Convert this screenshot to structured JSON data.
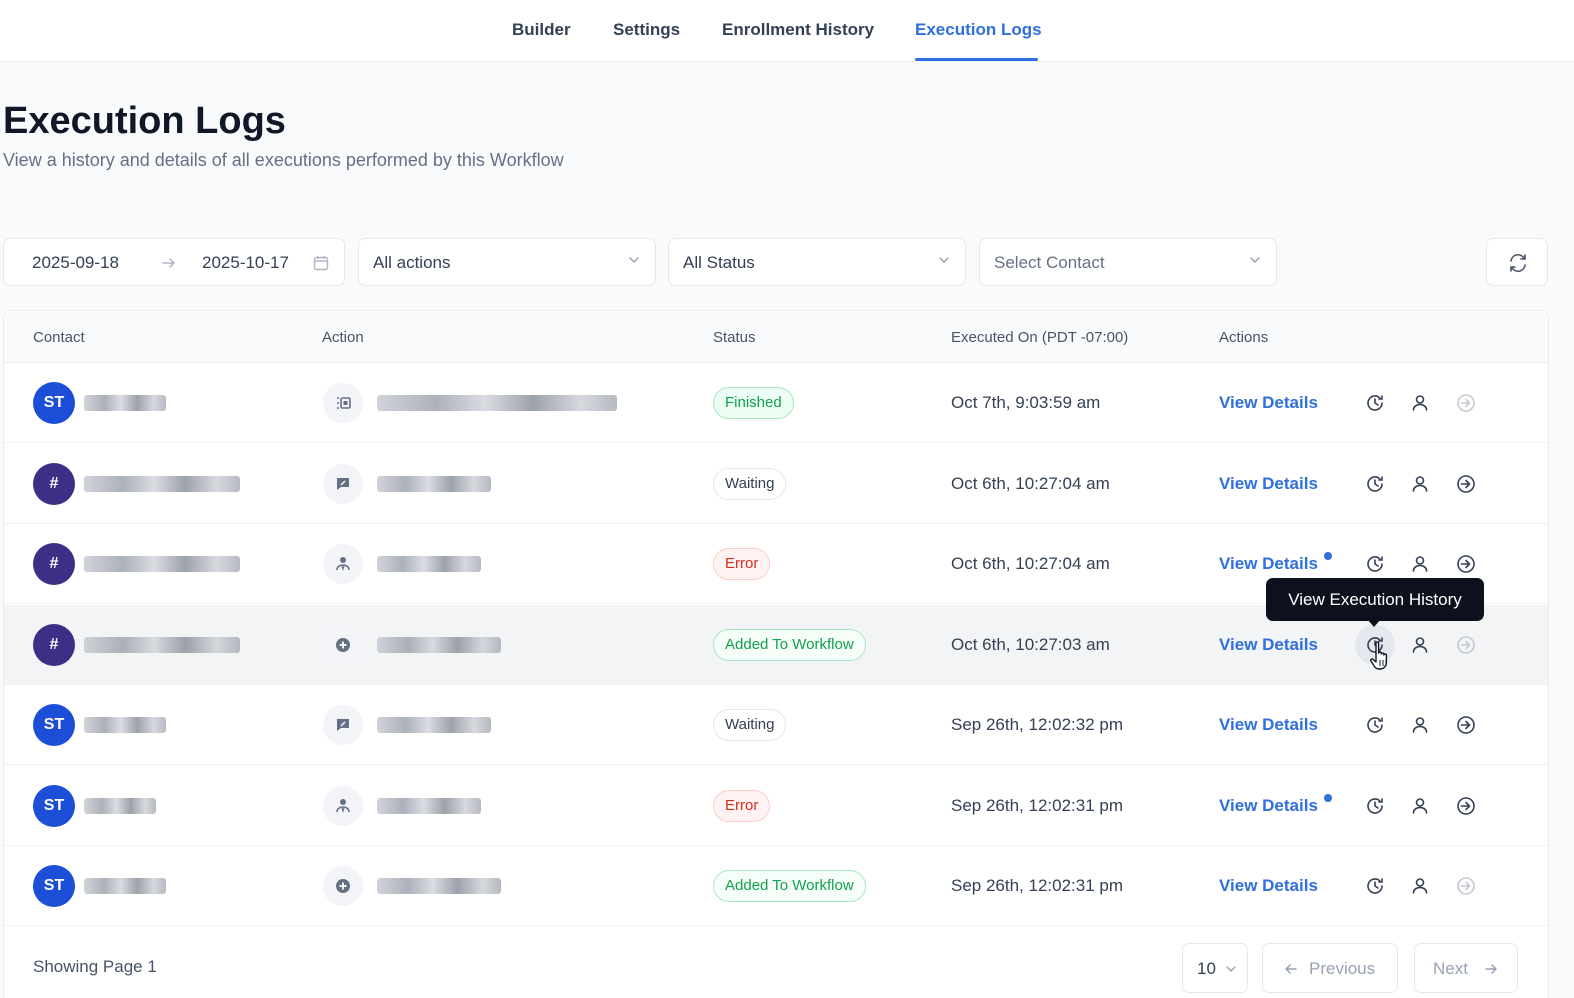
{
  "tabs": [
    {
      "label": "Builder",
      "active": false
    },
    {
      "label": "Settings",
      "active": false
    },
    {
      "label": "Enrollment History",
      "active": false
    },
    {
      "label": "Execution Logs",
      "active": true
    }
  ],
  "header": {
    "title": "Execution Logs",
    "subtitle": "View a history and details of all executions performed by this Workflow"
  },
  "filters": {
    "date_start": "2025-09-18",
    "date_end": "2025-10-17",
    "action_select": "All actions",
    "status_select": "All Status",
    "contact_placeholder": "Select Contact"
  },
  "table": {
    "columns": [
      "Contact",
      "Action",
      "Status",
      "Executed On (PDT -07:00)",
      "Actions"
    ],
    "rows": [
      {
        "avatar": "ST",
        "avatar_color": "#1d4ed8",
        "action_icon": "calendar-icon",
        "status": "Finished",
        "status_kind": "finished",
        "executed_on": "Oct 7th, 9:03:59 am",
        "view_label": "View Details",
        "has_dot": false
      },
      {
        "avatar": "#",
        "avatar_color": "#3b2f86",
        "action_icon": "message-icon",
        "status": "Waiting",
        "status_kind": "waiting",
        "executed_on": "Oct 6th, 10:27:04 am",
        "view_label": "View Details",
        "has_dot": false
      },
      {
        "avatar": "#",
        "avatar_color": "#3b2f86",
        "action_icon": "assign-user-icon",
        "status": "Error",
        "status_kind": "error",
        "executed_on": "Oct 6th, 10:27:04 am",
        "view_label": "View Details",
        "has_dot": true
      },
      {
        "avatar": "#",
        "avatar_color": "#3b2f86",
        "action_icon": "add-circle-icon",
        "status": "Added To Workflow",
        "status_kind": "added",
        "executed_on": "Oct 6th, 10:27:03 am",
        "view_label": "View Details",
        "has_dot": false
      },
      {
        "avatar": "ST",
        "avatar_color": "#1d4ed8",
        "action_icon": "message-icon",
        "status": "Waiting",
        "status_kind": "waiting",
        "executed_on": "Sep 26th, 12:02:32 pm",
        "view_label": "View Details",
        "has_dot": false
      },
      {
        "avatar": "ST",
        "avatar_color": "#1d4ed8",
        "action_icon": "assign-user-icon",
        "status": "Error",
        "status_kind": "error",
        "executed_on": "Sep 26th, 12:02:31 pm",
        "view_label": "View Details",
        "has_dot": true
      },
      {
        "avatar": "ST",
        "avatar_color": "#1d4ed8",
        "action_icon": "add-circle-icon",
        "status": "Added To Workflow",
        "status_kind": "added",
        "executed_on": "Sep 26th, 12:02:31 pm",
        "view_label": "View Details",
        "has_dot": false
      }
    ]
  },
  "tooltip": {
    "text": "View Execution History"
  },
  "pagination": {
    "showing": "Showing Page 1",
    "page_size": "10",
    "previous": "Previous",
    "next": "Next"
  },
  "colors": {
    "accent": "#2f6fde"
  }
}
